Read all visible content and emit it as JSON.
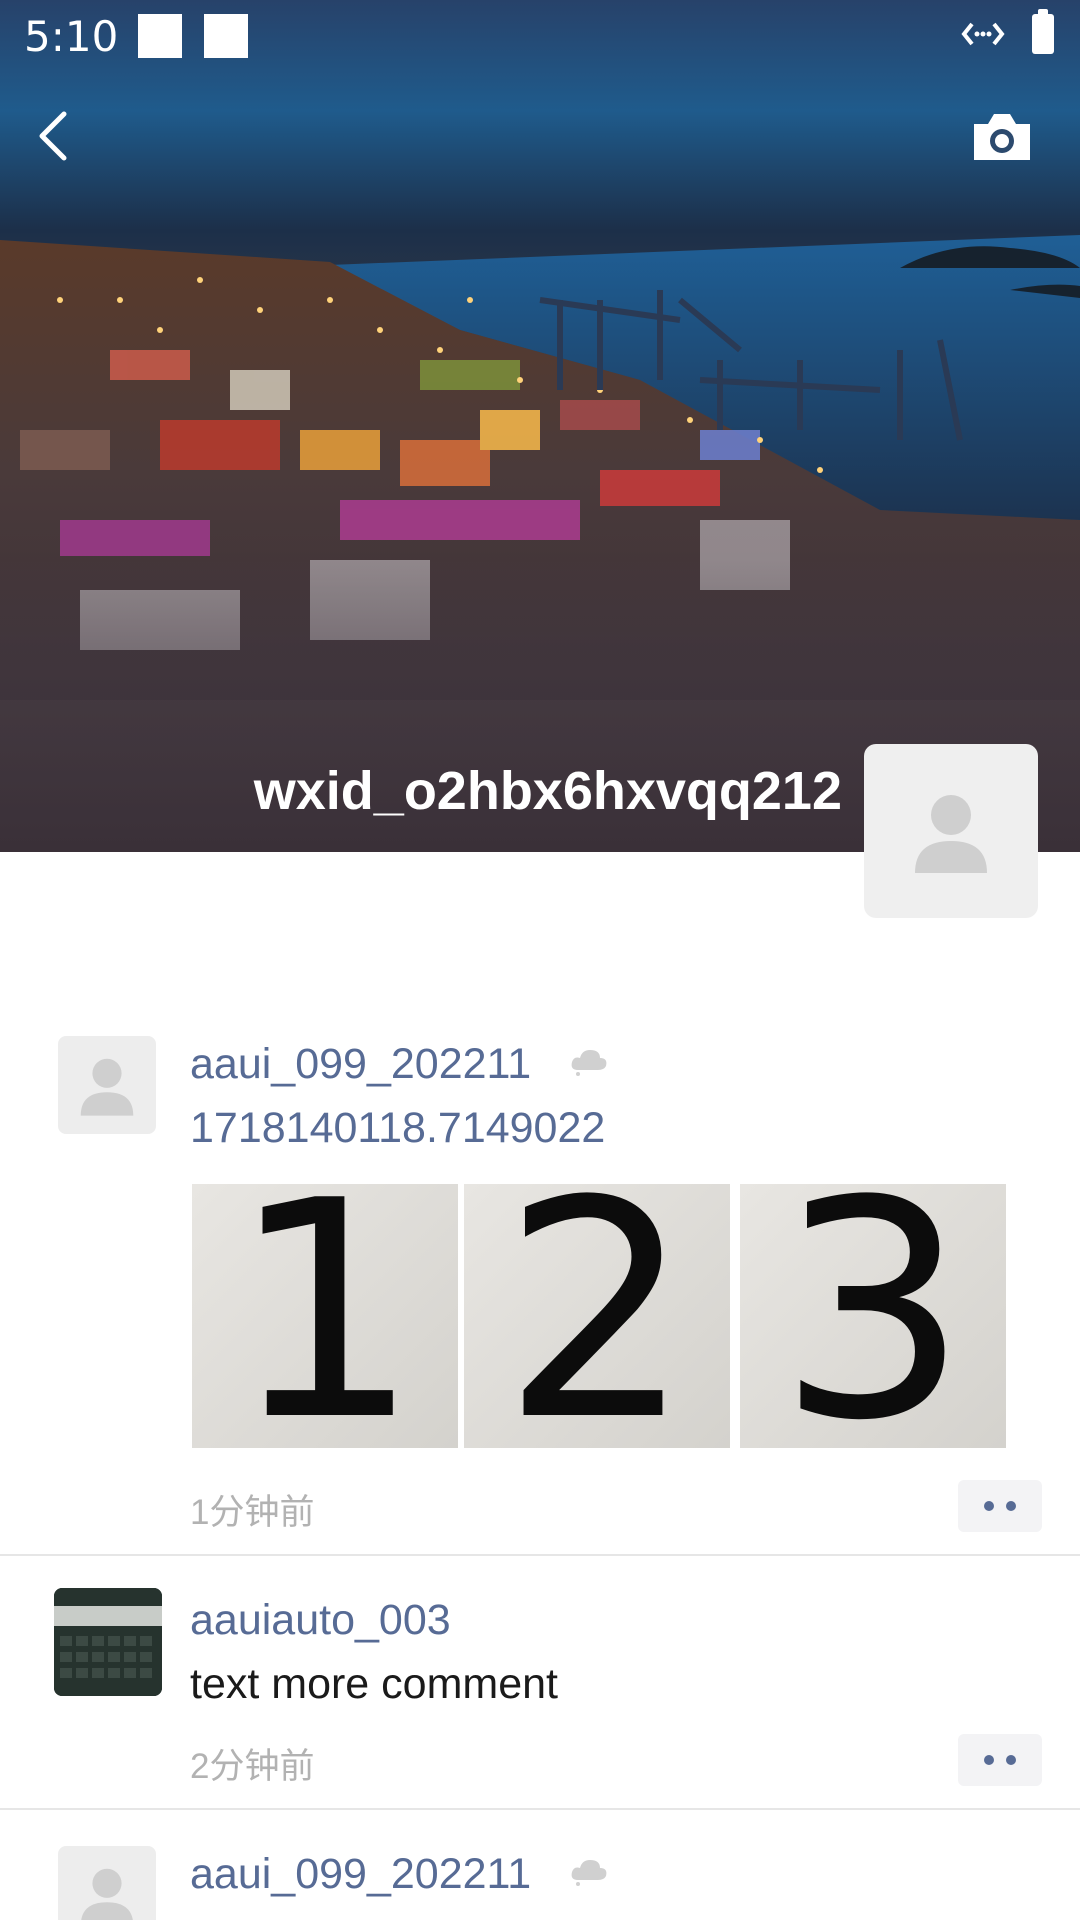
{
  "status_bar": {
    "time": "5:10",
    "icons": [
      "notification-square-icon",
      "notification-square-icon",
      "network-icon",
      "battery-icon"
    ]
  },
  "header": {
    "back_icon": "chevron-left-icon",
    "camera_icon": "camera-icon"
  },
  "profile": {
    "username": "wxid_o2hbx6hxvqq212",
    "avatar_icon": "person-placeholder-icon"
  },
  "posts": [
    {
      "author": "aaui_099_202211",
      "cloud_icon": "cloud-icon",
      "text": "1718140118.7149022",
      "images": [
        "1",
        "2",
        "3"
      ],
      "time": "1分钟前"
    },
    {
      "author": "aauiauto_003",
      "text": "text more comment",
      "time": "2分钟前"
    },
    {
      "author": "aaui_099_202211",
      "cloud_icon": "cloud-icon"
    }
  ],
  "colors": {
    "link_blue": "#576b95",
    "time_gray": "#b2b2b2",
    "divider": "#e6e6e6"
  }
}
